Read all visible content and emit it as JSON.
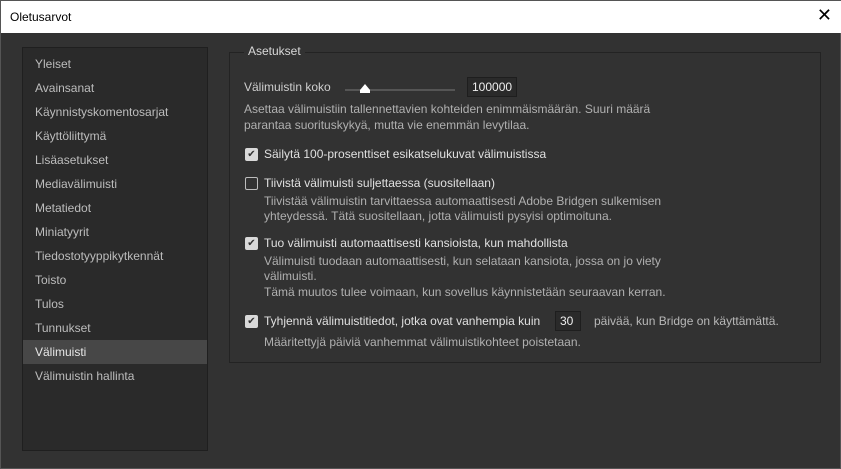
{
  "window": {
    "title": "Oletusarvot",
    "close": "✕"
  },
  "sidebar": {
    "items": [
      "Yleiset",
      "Avainsanat",
      "Käynnistyskomentosarjat",
      "Käyttöliittymä",
      "Lisäasetukset",
      "Mediavälimuisti",
      "Metatiedot",
      "Miniatyyrit",
      "Tiedostotyyppikytkennät",
      "Toisto",
      "Tulos",
      "Tunnukset",
      "Välimuisti",
      "Välimuistin hallinta"
    ],
    "selected": "Välimuisti"
  },
  "settings": {
    "legend": "Asetukset",
    "cache_size_label": "Välimuistin koko",
    "cache_size_value": "100000",
    "cache_size_slider_fraction": 0.2,
    "cache_size_desc1": "Asettaa välimuistiin tallennettavien kohteiden enimmäismäärän. Suuri määrä",
    "cache_size_desc2": "parantaa suorituskykyä, mutta vie enemmän levytilaa.",
    "keep_previews": {
      "label": "Säilytä 100-prosenttiset esikatselukuvat välimuistissa",
      "checked": true
    },
    "compact": {
      "label": "Tiivistä välimuisti suljettaessa (suositellaan)",
      "checked": false,
      "desc1": "Tiivistää välimuistin tarvittaessa automaattisesti Adobe Bridgen sulkemisen",
      "desc2": "yhteydessä. Tätä suositellaan, jotta välimuisti pysyisi optimoituna."
    },
    "auto_export": {
      "label": "Tuo välimuisti automaattisesti kansioista, kun mahdollista",
      "checked": true,
      "desc1": "Välimuisti tuodaan automaattisesti, kun selataan kansiota, jossa on jo viety",
      "desc2": "välimuisti.",
      "desc3": "Tämä muutos tulee voimaan, kun sovellus käynnistetään seuraavan kerran."
    },
    "purge": {
      "label": "Tyhjennä välimuistitiedot, jotka ovat vanhempia kuin",
      "days": "30",
      "suffix": "päivää, kun Bridge on käyttämättä.",
      "checked": true,
      "desc": "Määritettyjä päiviä vanhemmat välimuistikohteet poistetaan."
    },
    "check": "✔"
  }
}
